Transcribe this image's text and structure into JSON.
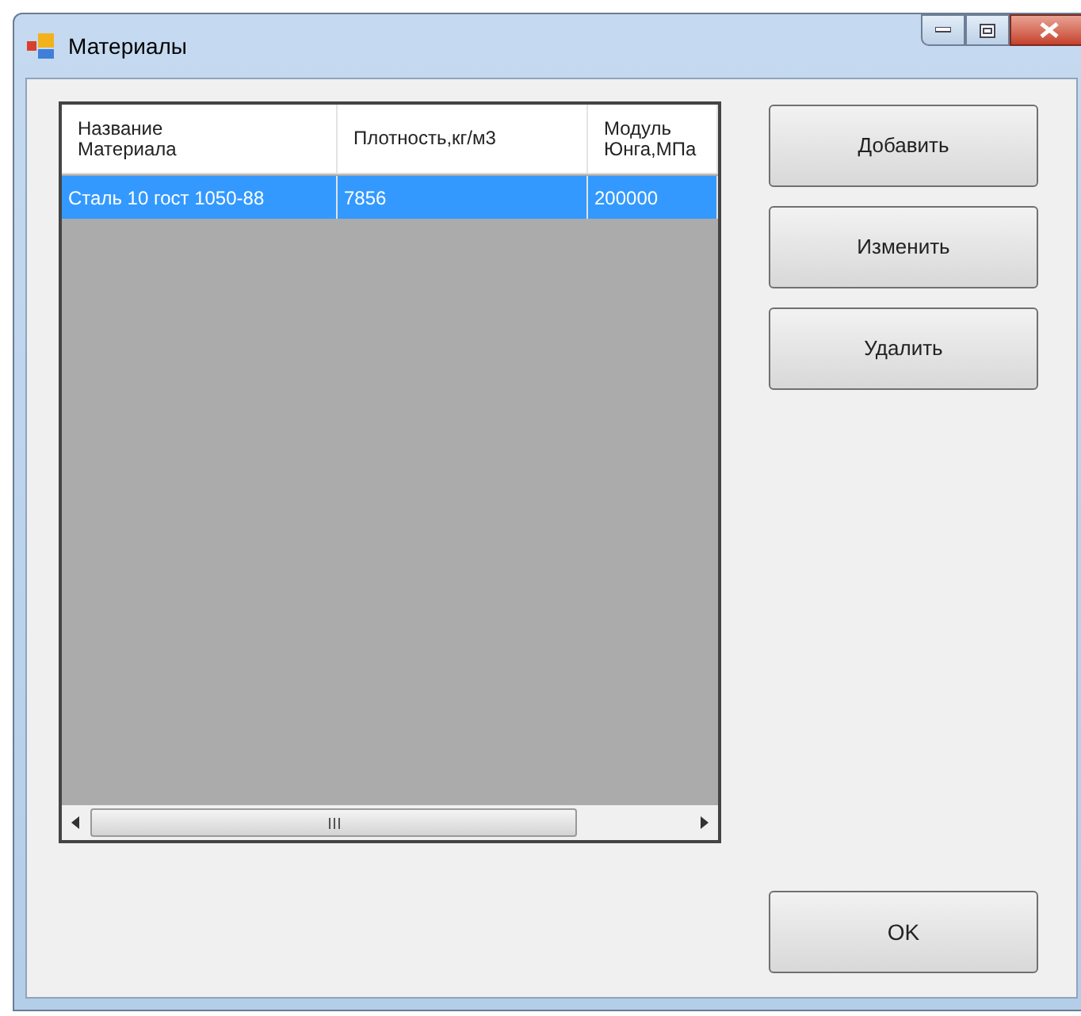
{
  "window": {
    "title": "Материалы"
  },
  "table": {
    "columns": [
      "Название\nМатериала",
      "Плотность,кг/м3",
      "Модуль\nЮнга,МПа"
    ],
    "rows": [
      {
        "cells": [
          "Сталь 10 гост 1050-88",
          "7856",
          "200000"
        ],
        "selected": true
      }
    ]
  },
  "buttons": [
    "Добавить",
    "Изменить",
    "Удалить"
  ],
  "ok_button": "OK"
}
